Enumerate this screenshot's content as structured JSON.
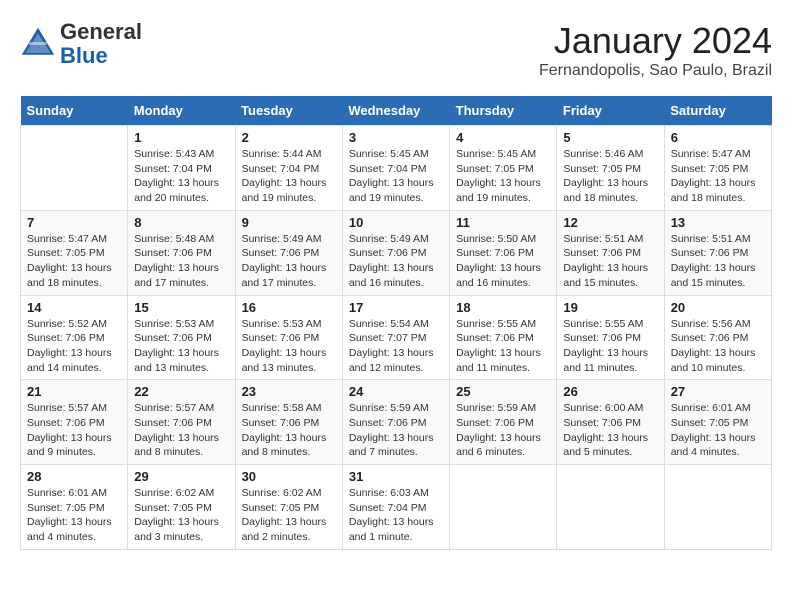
{
  "header": {
    "logo_line1": "General",
    "logo_line2": "Blue",
    "month": "January 2024",
    "location": "Fernandopolis, Sao Paulo, Brazil"
  },
  "days_of_week": [
    "Sunday",
    "Monday",
    "Tuesday",
    "Wednesday",
    "Thursday",
    "Friday",
    "Saturday"
  ],
  "weeks": [
    [
      {
        "day": "",
        "info": ""
      },
      {
        "day": "1",
        "info": "Sunrise: 5:43 AM\nSunset: 7:04 PM\nDaylight: 13 hours\nand 20 minutes."
      },
      {
        "day": "2",
        "info": "Sunrise: 5:44 AM\nSunset: 7:04 PM\nDaylight: 13 hours\nand 19 minutes."
      },
      {
        "day": "3",
        "info": "Sunrise: 5:45 AM\nSunset: 7:04 PM\nDaylight: 13 hours\nand 19 minutes."
      },
      {
        "day": "4",
        "info": "Sunrise: 5:45 AM\nSunset: 7:05 PM\nDaylight: 13 hours\nand 19 minutes."
      },
      {
        "day": "5",
        "info": "Sunrise: 5:46 AM\nSunset: 7:05 PM\nDaylight: 13 hours\nand 18 minutes."
      },
      {
        "day": "6",
        "info": "Sunrise: 5:47 AM\nSunset: 7:05 PM\nDaylight: 13 hours\nand 18 minutes."
      }
    ],
    [
      {
        "day": "7",
        "info": "Sunrise: 5:47 AM\nSunset: 7:05 PM\nDaylight: 13 hours\nand 18 minutes."
      },
      {
        "day": "8",
        "info": "Sunrise: 5:48 AM\nSunset: 7:06 PM\nDaylight: 13 hours\nand 17 minutes."
      },
      {
        "day": "9",
        "info": "Sunrise: 5:49 AM\nSunset: 7:06 PM\nDaylight: 13 hours\nand 17 minutes."
      },
      {
        "day": "10",
        "info": "Sunrise: 5:49 AM\nSunset: 7:06 PM\nDaylight: 13 hours\nand 16 minutes."
      },
      {
        "day": "11",
        "info": "Sunrise: 5:50 AM\nSunset: 7:06 PM\nDaylight: 13 hours\nand 16 minutes."
      },
      {
        "day": "12",
        "info": "Sunrise: 5:51 AM\nSunset: 7:06 PM\nDaylight: 13 hours\nand 15 minutes."
      },
      {
        "day": "13",
        "info": "Sunrise: 5:51 AM\nSunset: 7:06 PM\nDaylight: 13 hours\nand 15 minutes."
      }
    ],
    [
      {
        "day": "14",
        "info": "Sunrise: 5:52 AM\nSunset: 7:06 PM\nDaylight: 13 hours\nand 14 minutes."
      },
      {
        "day": "15",
        "info": "Sunrise: 5:53 AM\nSunset: 7:06 PM\nDaylight: 13 hours\nand 13 minutes."
      },
      {
        "day": "16",
        "info": "Sunrise: 5:53 AM\nSunset: 7:06 PM\nDaylight: 13 hours\nand 13 minutes."
      },
      {
        "day": "17",
        "info": "Sunrise: 5:54 AM\nSunset: 7:07 PM\nDaylight: 13 hours\nand 12 minutes."
      },
      {
        "day": "18",
        "info": "Sunrise: 5:55 AM\nSunset: 7:06 PM\nDaylight: 13 hours\nand 11 minutes."
      },
      {
        "day": "19",
        "info": "Sunrise: 5:55 AM\nSunset: 7:06 PM\nDaylight: 13 hours\nand 11 minutes."
      },
      {
        "day": "20",
        "info": "Sunrise: 5:56 AM\nSunset: 7:06 PM\nDaylight: 13 hours\nand 10 minutes."
      }
    ],
    [
      {
        "day": "21",
        "info": "Sunrise: 5:57 AM\nSunset: 7:06 PM\nDaylight: 13 hours\nand 9 minutes."
      },
      {
        "day": "22",
        "info": "Sunrise: 5:57 AM\nSunset: 7:06 PM\nDaylight: 13 hours\nand 8 minutes."
      },
      {
        "day": "23",
        "info": "Sunrise: 5:58 AM\nSunset: 7:06 PM\nDaylight: 13 hours\nand 8 minutes."
      },
      {
        "day": "24",
        "info": "Sunrise: 5:59 AM\nSunset: 7:06 PM\nDaylight: 13 hours\nand 7 minutes."
      },
      {
        "day": "25",
        "info": "Sunrise: 5:59 AM\nSunset: 7:06 PM\nDaylight: 13 hours\nand 6 minutes."
      },
      {
        "day": "26",
        "info": "Sunrise: 6:00 AM\nSunset: 7:06 PM\nDaylight: 13 hours\nand 5 minutes."
      },
      {
        "day": "27",
        "info": "Sunrise: 6:01 AM\nSunset: 7:05 PM\nDaylight: 13 hours\nand 4 minutes."
      }
    ],
    [
      {
        "day": "28",
        "info": "Sunrise: 6:01 AM\nSunset: 7:05 PM\nDaylight: 13 hours\nand 4 minutes."
      },
      {
        "day": "29",
        "info": "Sunrise: 6:02 AM\nSunset: 7:05 PM\nDaylight: 13 hours\nand 3 minutes."
      },
      {
        "day": "30",
        "info": "Sunrise: 6:02 AM\nSunset: 7:05 PM\nDaylight: 13 hours\nand 2 minutes."
      },
      {
        "day": "31",
        "info": "Sunrise: 6:03 AM\nSunset: 7:04 PM\nDaylight: 13 hours\nand 1 minute."
      },
      {
        "day": "",
        "info": ""
      },
      {
        "day": "",
        "info": ""
      },
      {
        "day": "",
        "info": ""
      }
    ]
  ]
}
